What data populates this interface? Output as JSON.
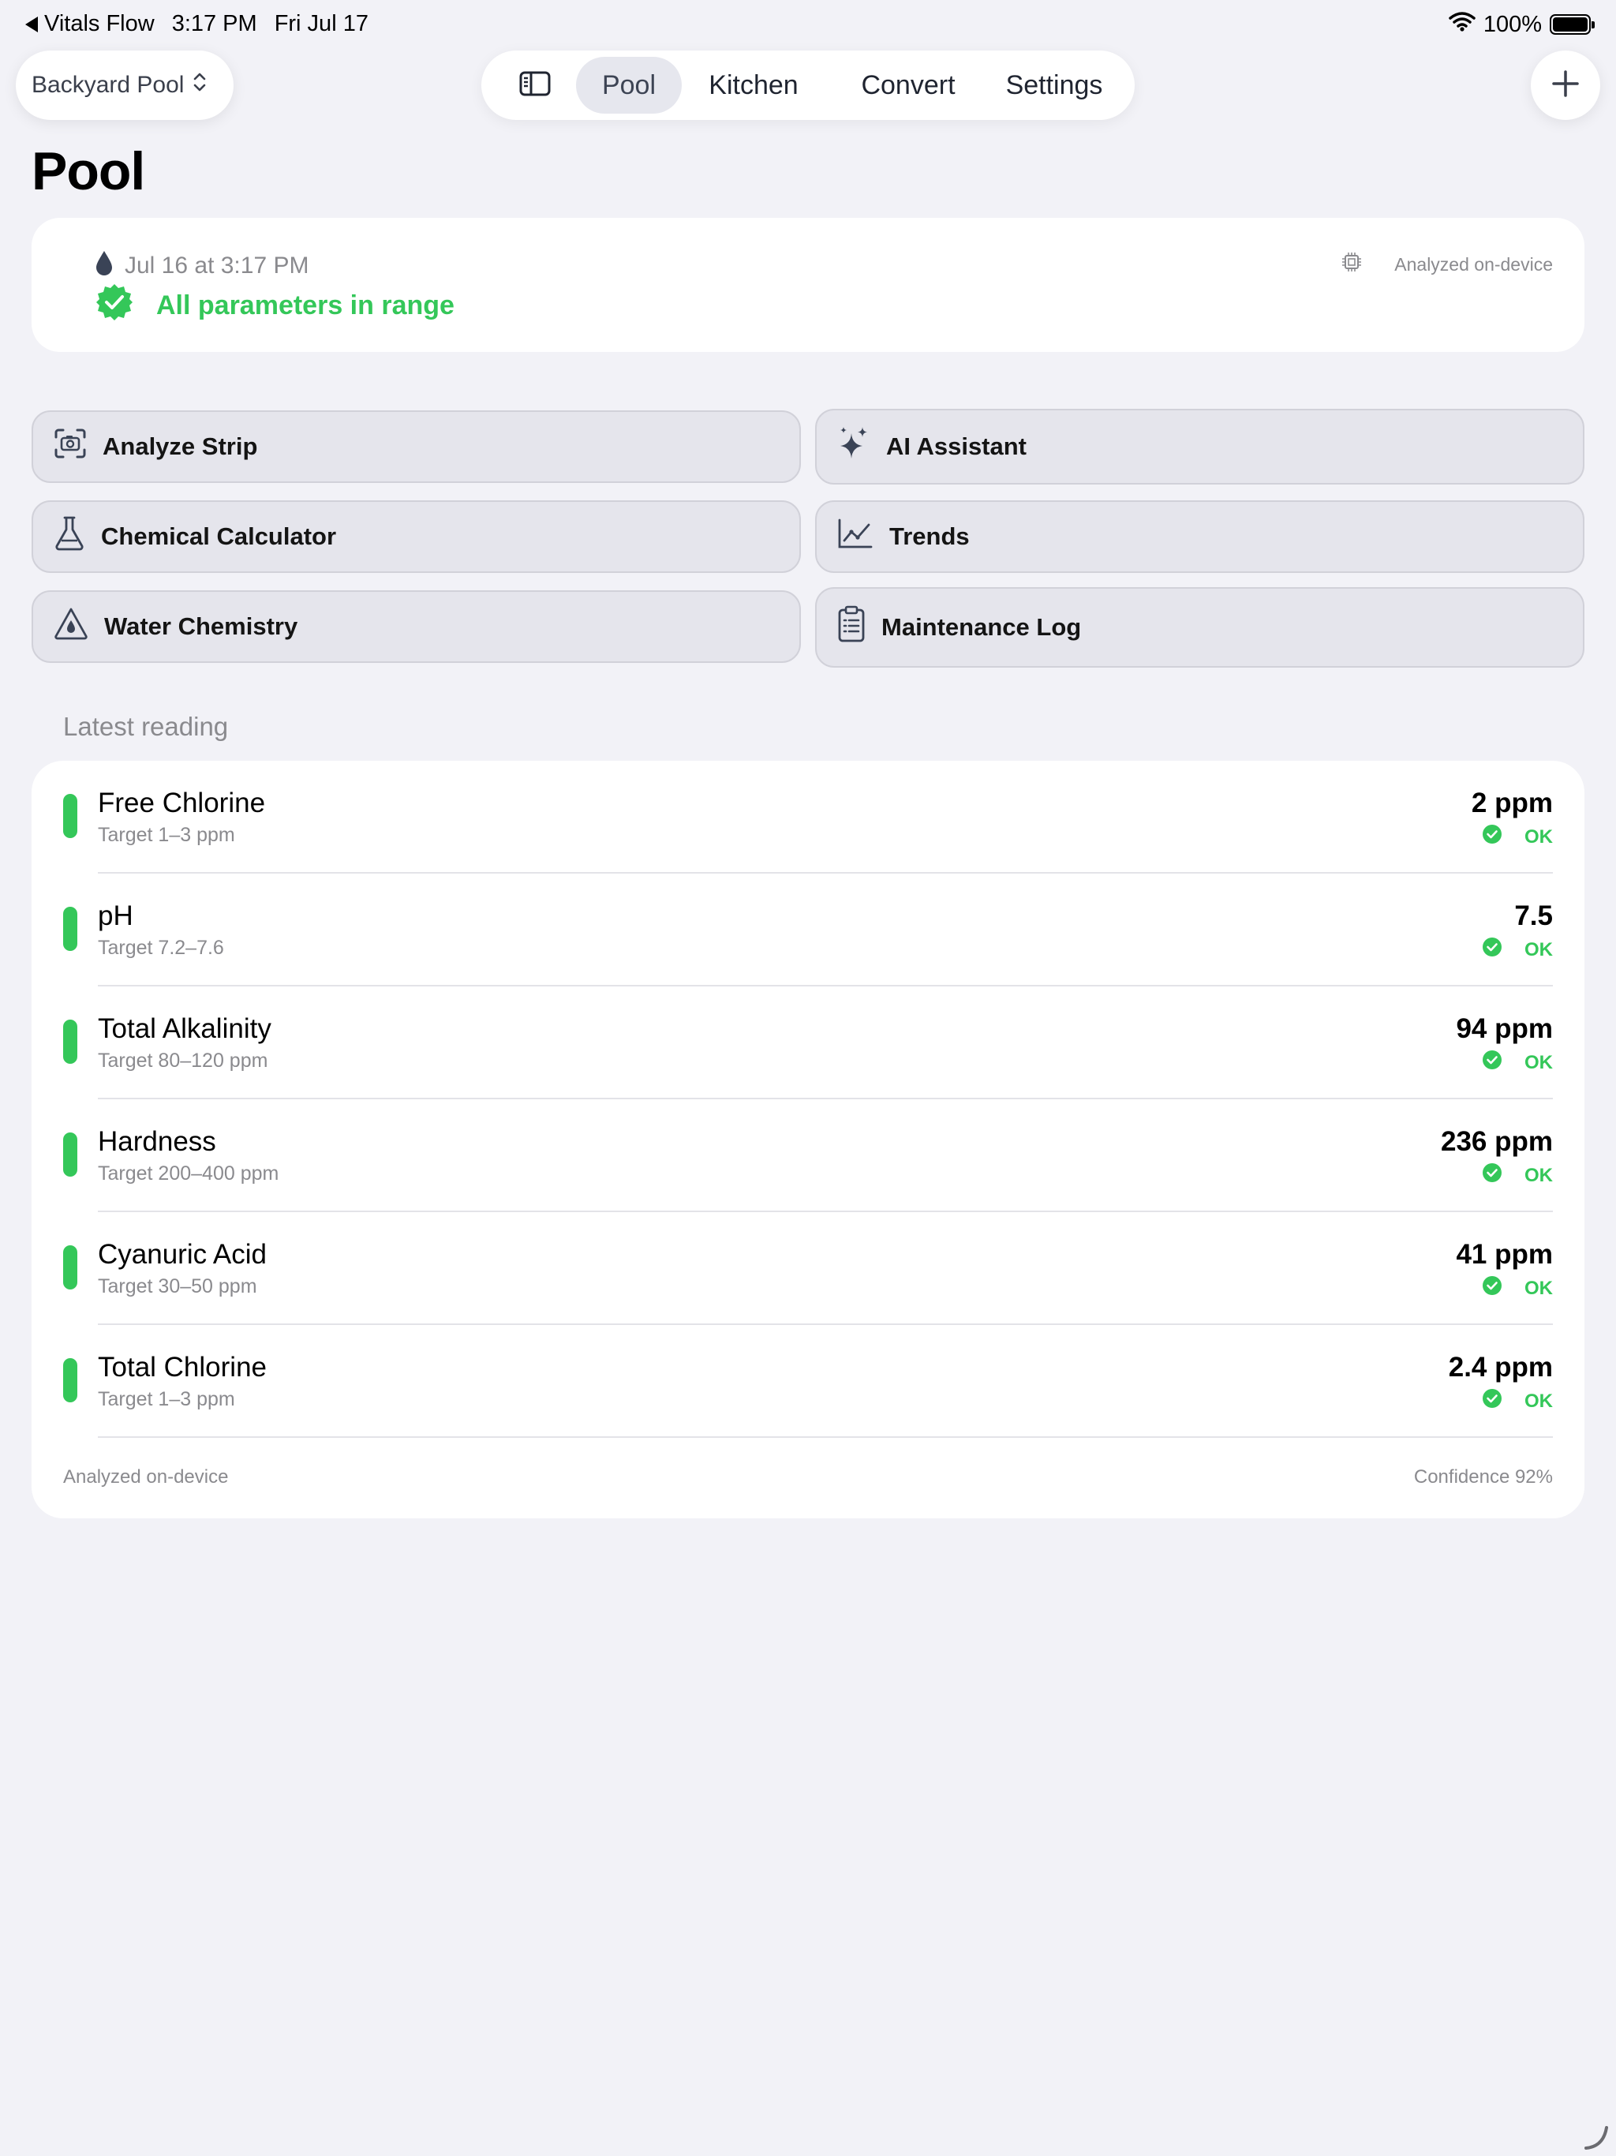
{
  "status_bar": {
    "back_app": "Vitals Flow",
    "time": "3:17 PM",
    "date": "Fri Jul 17",
    "battery": "100%"
  },
  "nav": {
    "pool_picker": "Backyard Pool",
    "tabs": [
      {
        "label": "Pool",
        "active": true
      },
      {
        "label": "Kitchen",
        "active": false
      },
      {
        "label": "Convert",
        "active": false
      },
      {
        "label": "Settings",
        "active": false
      }
    ]
  },
  "page_title": "Pool",
  "summary": {
    "timestamp": "Jul 16 at 3:17 PM",
    "status": "All parameters in range",
    "analysis": "Analyzed on-device"
  },
  "actions": [
    {
      "label": "Analyze Strip",
      "icon": "camera-scan-icon"
    },
    {
      "label": "AI Assistant",
      "icon": "sparkles-icon"
    },
    {
      "label": "Chemical Calculator",
      "icon": "flask-icon"
    },
    {
      "label": "Trends",
      "icon": "chart-line-icon"
    },
    {
      "label": "Water Chemistry",
      "icon": "water-drop-triangle-icon"
    },
    {
      "label": "Maintenance Log",
      "icon": "clipboard-icon"
    }
  ],
  "latest_reading": {
    "section_label": "Latest reading",
    "rows": [
      {
        "name": "Free Chlorine",
        "target": "Target 1–3 ppm",
        "value": "2 ppm",
        "status": "OK"
      },
      {
        "name": "pH",
        "target": "Target 7.2–7.6",
        "value": "7.5",
        "status": "OK"
      },
      {
        "name": "Total Alkalinity",
        "target": "Target 80–120 ppm",
        "value": "94 ppm",
        "status": "OK"
      },
      {
        "name": "Hardness",
        "target": "Target 200–400 ppm",
        "value": "236 ppm",
        "status": "OK"
      },
      {
        "name": "Cyanuric Acid",
        "target": "Target 30–50 ppm",
        "value": "41 ppm",
        "status": "OK"
      },
      {
        "name": "Total Chlorine",
        "target": "Target 1–3 ppm",
        "value": "2.4 ppm",
        "status": "OK"
      }
    ],
    "footer_left": "Analyzed on-device",
    "footer_right": "Confidence 92%"
  },
  "colors": {
    "accent_green": "#34c759",
    "background": "#f2f2f7",
    "card": "#ffffff"
  }
}
